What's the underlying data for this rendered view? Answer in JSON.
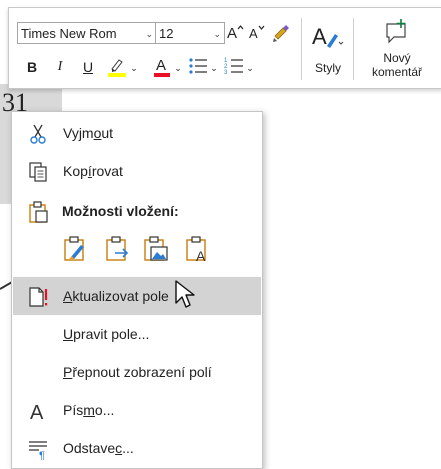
{
  "document": {
    "fragment_text": "31"
  },
  "mini_toolbar": {
    "font_name": "Times New Rom",
    "font_size": "12",
    "bold_label": "B",
    "italic_label": "I",
    "underline_label": "U",
    "styles_label": "Styly",
    "new_comment_line1": "Nový",
    "new_comment_line2": "komentář"
  },
  "context_menu": {
    "items": [
      {
        "pre": "Vyjm",
        "ul": "o",
        "post": "ut"
      },
      {
        "pre": "Kop",
        "ul": "í",
        "post": "rovat"
      },
      {
        "heading": "Možnosti vložení:"
      },
      {
        "pre": "",
        "ul": "A",
        "post": "ktualizovat pole"
      },
      {
        "pre": "",
        "ul": "U",
        "post": "pravit pole..."
      },
      {
        "pre": "",
        "ul": "P",
        "post": "řepnout zobrazení polí"
      },
      {
        "pre": "Pís",
        "ul": "m",
        "post": "o..."
      },
      {
        "pre": "Odstave",
        "ul": "c",
        "post": "..."
      }
    ]
  },
  "colors": {
    "highlight_yellow": "#ffff00",
    "font_red": "#e81123",
    "accent_blue": "#2b7cd3",
    "comment_green": "#107c41",
    "menu_hover": "#d3d3d3",
    "update_field_red": "#e81123"
  }
}
